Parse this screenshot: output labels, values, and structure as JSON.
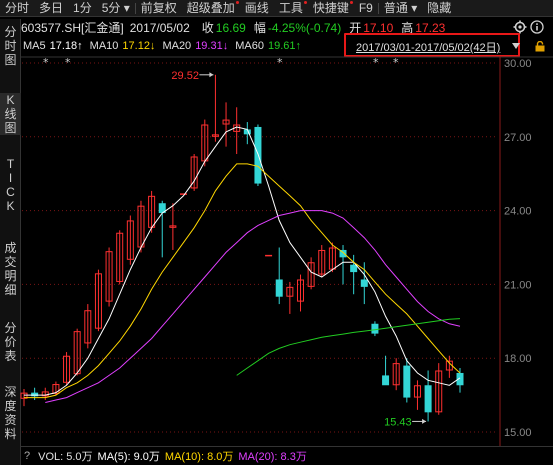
{
  "toolbar": {
    "items": [
      "分时",
      "多日",
      "1分",
      "5分",
      "前复权",
      "超级叠加",
      "画线",
      "工具",
      "快捷键",
      "F9",
      "普通",
      "隐藏"
    ],
    "dots": [
      false,
      false,
      false,
      false,
      false,
      true,
      false,
      true,
      true,
      false,
      false,
      false
    ],
    "dropdowns": [
      false,
      false,
      false,
      true,
      false,
      false,
      false,
      false,
      false,
      false,
      true,
      false
    ]
  },
  "sidebar": {
    "items": [
      "分时图",
      "K线图",
      "TICK",
      "成交明细",
      "分价表",
      "深度资料"
    ]
  },
  "header": {
    "code": "603577.SH[汇金通]",
    "date": "2017/05/02",
    "close_label": "收",
    "close_value": "16.69",
    "change_label": "幅",
    "change_value": "-4.25%(-0.74)",
    "open_label": "开",
    "open_value": "17.10",
    "high_label": "高",
    "high_value": "17.23"
  },
  "ma": {
    "ma5_label": "MA5",
    "ma5_value": "17.18↑",
    "ma10_label": "MA10",
    "ma10_value": "17.12↓",
    "ma20_label": "MA20",
    "ma20_value": "19.31↓",
    "ma60_label": "MA60",
    "ma60_value": "19.61↑"
  },
  "range": {
    "text": "2017/03/01-2017/05/02(42日)"
  },
  "volume": {
    "question": "?",
    "vol": "VOL: 5.0万",
    "ma5": "MA(5): 9.0万",
    "ma10": "MA(10): 8.0万",
    "ma20": "MA(20): 8.3万"
  },
  "colors": {
    "up": "#ff3030",
    "down": "#33d6d6",
    "ma5": "#ffffff",
    "ma10": "#ffd700",
    "ma20": "#e040ff",
    "ma60": "#22cc22",
    "down_text": "#22cc22"
  },
  "chart_data": {
    "type": "candlestick",
    "ylim": [
      15,
      30
    ],
    "y_ticks": [
      "30.00",
      "27.00",
      "24.00",
      "21.00",
      "18.00",
      "15.00"
    ],
    "y_tick_values": [
      30,
      27,
      24,
      21,
      18,
      15
    ],
    "annotations": {
      "high": "29.52",
      "high_value": 29.52,
      "low": "15.43",
      "low_value": 15.43
    },
    "markers": "*",
    "candles": [
      {
        "o": 16.35,
        "h": 16.75,
        "l": 16.05,
        "c": 16.6
      },
      {
        "o": 16.6,
        "h": 16.8,
        "l": 16.3,
        "c": 16.45
      },
      {
        "o": 16.45,
        "h": 16.8,
        "l": 16.3,
        "c": 16.65
      },
      {
        "o": 16.55,
        "h": 17.05,
        "l": 16.5,
        "c": 16.95
      },
      {
        "o": 17.0,
        "h": 18.25,
        "l": 16.9,
        "c": 18.1
      },
      {
        "o": 17.35,
        "h": 19.2,
        "l": 17.3,
        "c": 19.1
      },
      {
        "o": 18.6,
        "h": 20.2,
        "l": 18.4,
        "c": 19.95
      },
      {
        "o": 19.2,
        "h": 21.6,
        "l": 19.1,
        "c": 21.45
      },
      {
        "o": 20.3,
        "h": 22.5,
        "l": 20.1,
        "c": 22.35
      },
      {
        "o": 21.1,
        "h": 23.2,
        "l": 21.0,
        "c": 23.1
      },
      {
        "o": 22.0,
        "h": 23.8,
        "l": 21.8,
        "c": 23.6
      },
      {
        "o": 22.5,
        "h": 24.4,
        "l": 22.3,
        "c": 24.2
      },
      {
        "o": 23.3,
        "h": 24.8,
        "l": 23.1,
        "c": 24.6
      },
      {
        "o": 24.3,
        "h": 24.4,
        "l": 22.1,
        "c": 23.9
      },
      {
        "o": 23.3,
        "h": 24.3,
        "l": 22.4,
        "c": 23.4
      },
      {
        "o": 24.7,
        "h": 24.7,
        "l": 24.7,
        "c": 24.7
      },
      {
        "o": 24.9,
        "h": 26.3,
        "l": 24.8,
        "c": 26.2
      },
      {
        "o": 26.0,
        "h": 27.7,
        "l": 25.8,
        "c": 27.5
      },
      {
        "o": 27.0,
        "h": 29.52,
        "l": 26.8,
        "c": 27.1
      },
      {
        "o": 27.5,
        "h": 28.4,
        "l": 26.6,
        "c": 27.7
      },
      {
        "o": 27.2,
        "h": 28.2,
        "l": 26.3,
        "c": 27.5
      },
      {
        "o": 27.3,
        "h": 27.6,
        "l": 26.7,
        "c": 27.1
      },
      {
        "o": 27.4,
        "h": 27.5,
        "l": 25.0,
        "c": 25.1
      },
      {
        "o": 22.2,
        "h": 22.2,
        "l": 22.2,
        "c": 22.2
      },
      {
        "o": 21.2,
        "h": 22.5,
        "l": 20.2,
        "c": 20.5
      },
      {
        "o": 20.5,
        "h": 21.1,
        "l": 19.8,
        "c": 20.9
      },
      {
        "o": 20.3,
        "h": 21.4,
        "l": 19.9,
        "c": 21.2
      },
      {
        "o": 20.9,
        "h": 22.1,
        "l": 20.8,
        "c": 21.9
      },
      {
        "o": 21.4,
        "h": 22.6,
        "l": 21.3,
        "c": 22.4
      },
      {
        "o": 21.6,
        "h": 22.7,
        "l": 21.5,
        "c": 22.5
      },
      {
        "o": 22.4,
        "h": 22.6,
        "l": 21.0,
        "c": 22.1
      },
      {
        "o": 21.8,
        "h": 22.2,
        "l": 20.6,
        "c": 21.5
      },
      {
        "o": 21.2,
        "h": 21.9,
        "l": 20.2,
        "c": 20.9
      },
      {
        "o": 19.4,
        "h": 19.5,
        "l": 18.9,
        "c": 19.0
      },
      {
        "o": 17.3,
        "h": 18.1,
        "l": 17.0,
        "c": 16.9
      },
      {
        "o": 16.9,
        "h": 18.0,
        "l": 16.7,
        "c": 17.8
      },
      {
        "o": 17.7,
        "h": 18.0,
        "l": 16.2,
        "c": 16.4
      },
      {
        "o": 16.4,
        "h": 17.1,
        "l": 15.9,
        "c": 16.9
      },
      {
        "o": 16.9,
        "h": 17.5,
        "l": 15.43,
        "c": 15.8
      },
      {
        "o": 15.8,
        "h": 17.8,
        "l": 15.7,
        "c": 17.5
      },
      {
        "o": 17.5,
        "h": 18.1,
        "l": 17.2,
        "c": 17.9
      },
      {
        "o": 17.4,
        "h": 17.6,
        "l": 16.6,
        "c": 16.9
      }
    ],
    "series": [
      {
        "name": "MA5",
        "values": [
          16.5,
          16.5,
          16.5,
          16.6,
          16.9,
          17.4,
          18.0,
          18.8,
          19.6,
          20.6,
          21.6,
          22.5,
          23.3,
          23.9,
          24.2,
          24.6,
          25.2,
          26.0,
          26.6,
          27.2,
          27.4,
          27.3,
          26.3,
          25.0,
          23.6,
          22.7,
          22.1,
          21.5,
          21.3,
          21.6,
          21.9,
          21.9,
          21.4,
          20.7,
          19.7,
          18.9,
          17.9,
          17.4,
          17.1,
          17.0,
          16.9,
          17.2
        ]
      },
      {
        "name": "MA10",
        "values": [
          16.4,
          16.4,
          16.4,
          16.5,
          16.8,
          17.0,
          17.3,
          17.7,
          18.2,
          18.7,
          19.3,
          20.0,
          20.8,
          21.5,
          22.1,
          22.7,
          23.3,
          24.0,
          24.8,
          25.4,
          25.9,
          25.9,
          25.8,
          25.4,
          25.0,
          24.6,
          24.2,
          23.6,
          23.1,
          22.6,
          22.3,
          21.9,
          21.6,
          21.1,
          20.6,
          20.2,
          19.8,
          19.3,
          18.8,
          18.3,
          17.8,
          17.4
        ]
      },
      {
        "name": "MA20",
        "values": [
          null,
          null,
          16.2,
          16.3,
          16.4,
          16.6,
          16.8,
          17.0,
          17.3,
          17.6,
          18.0,
          18.4,
          18.8,
          19.3,
          19.8,
          20.3,
          20.8,
          21.3,
          21.8,
          22.3,
          22.7,
          23.1,
          23.4,
          23.6,
          23.8,
          23.9,
          24.0,
          24.0,
          24.0,
          23.9,
          23.7,
          23.3,
          22.9,
          22.4,
          21.8,
          21.3,
          20.8,
          20.3,
          19.9,
          19.6,
          19.4,
          19.3
        ]
      },
      {
        "name": "MA60",
        "values": [
          null,
          null,
          null,
          null,
          null,
          null,
          null,
          null,
          null,
          null,
          null,
          null,
          null,
          null,
          null,
          null,
          null,
          null,
          null,
          null,
          17.3,
          17.6,
          17.9,
          18.2,
          18.4,
          18.55,
          18.65,
          18.75,
          18.85,
          18.92,
          18.98,
          19.05,
          19.1,
          19.16,
          19.22,
          19.28,
          19.34,
          19.4,
          19.46,
          19.52,
          19.58,
          19.61
        ]
      }
    ]
  }
}
